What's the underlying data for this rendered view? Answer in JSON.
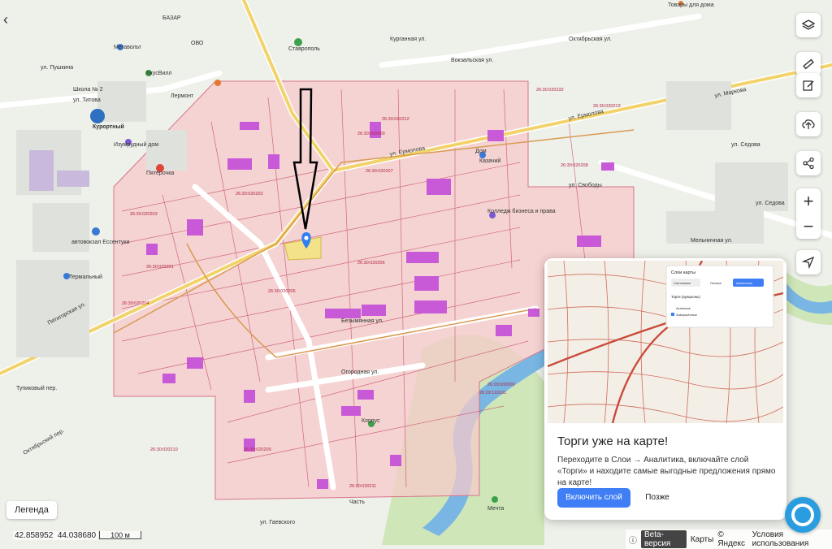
{
  "map": {
    "labels": {
      "kurortny": "Курортный",
      "bazaar": "БАЗАР",
      "goodhouse": "Товары для дома",
      "megavolt": "Мегавольт",
      "ovo": "ОВО",
      "kurgan_st": "Курганная ул.",
      "bolshaya_st": "Вокзальская ул.",
      "oktyabrskaya_st": "Октябрьская ул.",
      "pushkin_st": "ул. Пушкина",
      "school": "Школа № 2",
      "titov_st": "ул. Титова",
      "stavropol": "Ставрополь",
      "vkusvill": "ВкусВилл",
      "dom": "Дом",
      "lermont": "Лермонт",
      "izumrud": "Изумрудный дом",
      "pyaterochka": "Пятёрочка",
      "avtovokzal": "автовокзал Ессентуки",
      "termal": "Термальный",
      "pyatigorsk_st": "Пятигорская ул.",
      "erm_st": "ул. Ермолова",
      "erm_st2": "ул. Ермолова",
      "marx_st": "ул. Маркова",
      "sedova_st": "ул. Седова",
      "sedova_st2": "ул. Седова",
      "kolledzh": "Колледж бизнеса и права",
      "bezymyan": "Безымянная ул.",
      "ogorod_st": "Огородная ул.",
      "oktyab_left": "Октябрьский пер.",
      "gaevsk": "ул. Гаевского",
      "mecheta": "Мечта",
      "melnich": "Мельничная ул.",
      "korpus": "Корпус",
      "chast": "Часть",
      "kazachiy": "Казачий",
      "svobody_st": "ул. Свободы",
      "tupik": "Тупиковый пер.",
      "cadastral": [
        "26:30:020232",
        "26:30:020213",
        "26:30:020212",
        "26:30:000000",
        "26:30:020208",
        "26:30:020207",
        "26:30:020206",
        "26:30:020205",
        "26:30:020204",
        "26:30:020203",
        "26:30:020202",
        "26:30:020201",
        "26:30:020209",
        "26:30:020210",
        "26:29:000000",
        "26:29:110101",
        "26:30:020211"
      ]
    },
    "colors": {
      "overlay": "#f5c9c9",
      "roads": "#ffffff",
      "mainroad": "#f2d36b",
      "parcel": "#c43a5a",
      "building": "#c85ad8",
      "river": "#79b6e3",
      "green": "#cfe6b8",
      "marker": "#2f7ff0"
    }
  },
  "controls": {
    "back": "‹",
    "layers": "layers-icon",
    "ruler": "ruler-icon",
    "edit": "edit-icon",
    "upload": "upload-icon",
    "share": "share-icon",
    "zoom_in": "+",
    "zoom_out": "−",
    "locate": "locate-icon"
  },
  "legend": {
    "label": "Легенда"
  },
  "coords": {
    "lat": "42.858952",
    "lon": "44.038680"
  },
  "scale": {
    "label": "100 м"
  },
  "bottom": {
    "beta": "Beta-версия",
    "maps": "Карты",
    "copyright": "© Яндекс",
    "terms": "Условия использования"
  },
  "popup": {
    "title": "Торги уже на карте!",
    "text": "Переходите в Слои → Аналитика, включайте слой «Торги» и находите самые выгодные предложения прямо на карте!",
    "primary": "Включить слой",
    "secondary": "Позже",
    "thumb": {
      "panel_title": "Слои карты",
      "tabs": [
        "Системные",
        "Личные",
        "Аналитика"
      ],
      "row1": "Торги (аукционы)",
      "opt1": "Активные",
      "opt2": "Завершённые"
    }
  }
}
